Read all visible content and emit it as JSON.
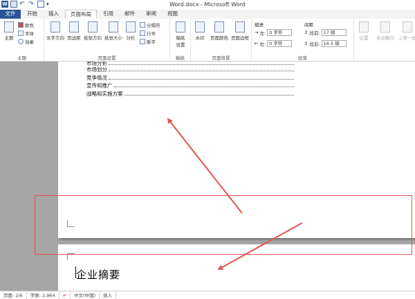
{
  "window": {
    "title": "Word.docx - Microsoft Word"
  },
  "tabs": [
    {
      "label": "文件"
    },
    {
      "label": "开始"
    },
    {
      "label": "插入"
    },
    {
      "label": "页面布局"
    },
    {
      "label": "引用"
    },
    {
      "label": "邮件"
    },
    {
      "label": "审阅"
    },
    {
      "label": "视图"
    }
  ],
  "ribbon": {
    "theme": {
      "main": "主题",
      "colors": "颜色",
      "fonts": "字体",
      "effects": "效果",
      "group_label": "主题"
    },
    "page_setup": {
      "text_direction": "文字方向",
      "margins": "页边距",
      "orientation": "纸张方向",
      "size": "纸张大小",
      "columns": "分栏",
      "breaks": "分隔符",
      "line_numbers": "行号",
      "hyphenation": "断字",
      "group_label": "页面设置"
    },
    "manuscript": {
      "settings": "稿纸\n设置",
      "group_label": "稿纸"
    },
    "page_background": {
      "watermark": "水印",
      "page_color": "页面颜色",
      "page_borders": "页面边框",
      "group_label": "页面背景"
    },
    "paragraph": {
      "indent_label": "缩进",
      "spacing_label": "间距",
      "left_label": "左:",
      "left_value": "0 字符",
      "right_label": "右:",
      "right_value": "0 字符",
      "before_label": "段前:",
      "before_value": "17 磅",
      "after_label": "段后:",
      "after_value": "16.5 磅",
      "group_label": "段落"
    },
    "arrange": {
      "position": "位置",
      "wrap_text": "自动换行",
      "bring_forward": "上移一层"
    }
  },
  "document": {
    "toc": [
      {
        "text": "市场分析"
      },
      {
        "text": "市场划分"
      },
      {
        "text": "竞争情况"
      },
      {
        "text": "宣传和推广"
      },
      {
        "text": "战略和实施方案"
      }
    ],
    "heading": "企业摘要"
  },
  "statusbar": {
    "page": "页面: 2/6",
    "words": "字数: 2,964",
    "language": "中文(中国)",
    "mode": "插入"
  },
  "colors": {
    "file_tab": "#2a5699",
    "annotation": "#e4534e",
    "workspace": "#a5a5a5"
  }
}
